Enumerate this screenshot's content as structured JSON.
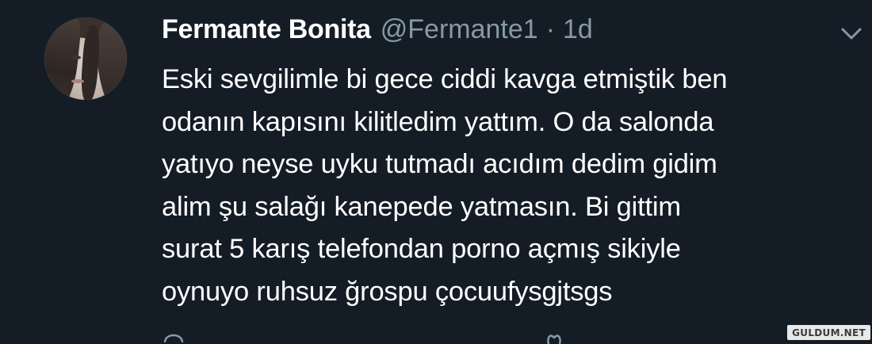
{
  "tweet": {
    "author": {
      "display_name": "Fermante Bonita",
      "handle": "@Fermante1",
      "separator": "·",
      "timestamp": "1d"
    },
    "text_lines": [
      "Eski sevgilimle bi gece ciddi kavga etmiştik ben",
      "odanın kapısını kilitledim yattım. O da salonda",
      "yatıyo neyse uyku tutmadı acıdım dedim gidim",
      "alim şu salağı kanepede yatmasın. Bi gittim",
      "surat 5 karış telefondan porno açmış sikiyle",
      "oynuyo ruhsuz ğrospu çocuufysgjtsgs"
    ],
    "menu_icon": "chevron-down-icon"
  },
  "watermark": {
    "text": "GULDUM.NET"
  },
  "colors": {
    "background": "#141d26",
    "text_primary": "#ffffff",
    "text_secondary": "#8899a6"
  }
}
